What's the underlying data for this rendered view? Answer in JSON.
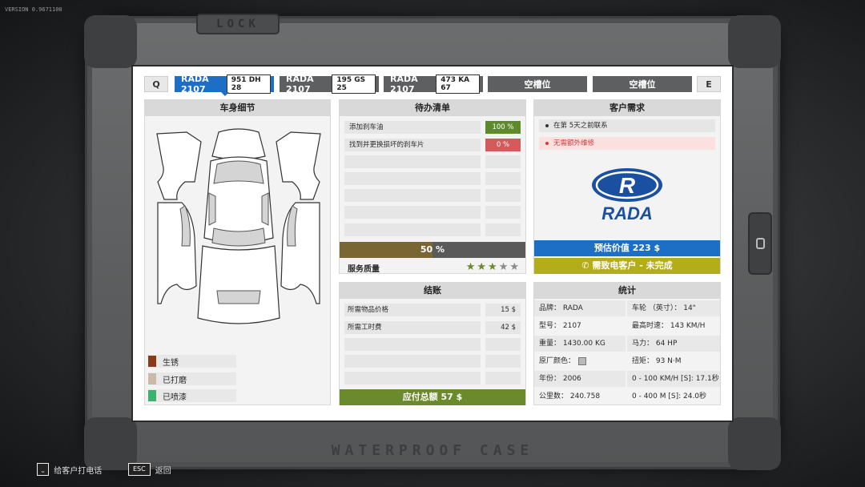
{
  "version": "VERSION 0.9671100",
  "case": {
    "lock_label": "LOCK",
    "bottom_label": "WATERPROOF CASE"
  },
  "slots": {
    "prev_key": "Q",
    "next_key": "E",
    "cars": [
      {
        "name": "RADA 2107",
        "plate": "951 DH 28",
        "active": true
      },
      {
        "name": "RADA 2107",
        "plate": "195 GS 25",
        "active": false
      },
      {
        "name": "RADA 2107",
        "plate": "473 KA 67",
        "active": false
      }
    ],
    "empty_label": "空槽位"
  },
  "body_panel": {
    "title": "车身细节",
    "legend": [
      {
        "label": "生锈",
        "color": "#8b3a1a"
      },
      {
        "label": "已打磨",
        "color": "#c8bca8"
      },
      {
        "label": "已喷漆",
        "color": "#3bb36a"
      }
    ]
  },
  "todo_panel": {
    "title": "待办清单",
    "tasks": [
      {
        "label": "添加刹车油",
        "value": "100 %",
        "color": "#5f8a2a"
      },
      {
        "label": "找到并更换损坏的刹车片",
        "value": "0 %",
        "color": "#d55a5a"
      }
    ],
    "progress": {
      "text": "50 %",
      "fraction": 0.5
    },
    "service_quality": {
      "label": "服务质量",
      "stars": 3,
      "max_stars": 5
    }
  },
  "customer_panel": {
    "title": "客户需求",
    "requirements": [
      {
        "text": "在第 5天之前联系",
        "warn": false
      },
      {
        "text": "无需额外维修",
        "warn": true
      }
    ],
    "brand_logo": "RADA",
    "estimated_value": "预估价值 223 $",
    "call_status": "需致电客户 - 未完成",
    "phone_icon": "phone-icon",
    "colors": {
      "value_bar": "#1d6ec5",
      "call_bar": "#b3ad1a"
    }
  },
  "checkout_panel": {
    "title": "结账",
    "rows": [
      {
        "label": "所需物品价格",
        "value": "15 $"
      },
      {
        "label": "所需工时费",
        "value": "42 $"
      }
    ],
    "total": "应付总额 57 $",
    "total_color": "#6a8a2c"
  },
  "stats_panel": {
    "title": "统计",
    "rows": [
      {
        "left": "品牌： RADA",
        "right": "车轮 （英寸）： 14\""
      },
      {
        "left": "型号： 2107",
        "right": "最高时速： 143 KM/H"
      },
      {
        "left": "重量： 1430.00 KG",
        "right": "马力： 64 HP"
      },
      {
        "left": "原厂颜色：",
        "right": "扭矩： 93 N·M"
      },
      {
        "left": "年份： 2006",
        "right": "0 - 100 KM/H [S]: 17.1秒"
      },
      {
        "left": "公里数： 240.758",
        "right": "0 - 400 M [S]: 24.0秒"
      }
    ]
  },
  "footer": {
    "call": {
      "key": "⎵",
      "label": "给客户打电话"
    },
    "back": {
      "key": "ESC",
      "label": "返回"
    }
  }
}
